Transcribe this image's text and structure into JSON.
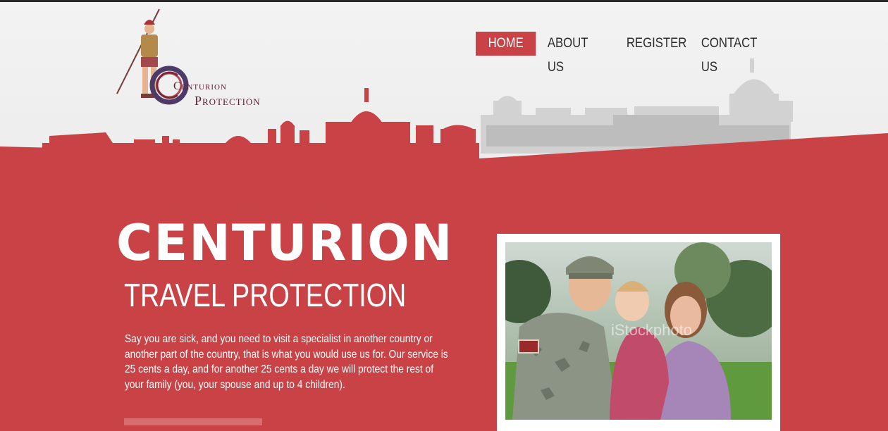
{
  "logo": {
    "word1": "Centurion",
    "word2": "Protection"
  },
  "nav": {
    "items": [
      {
        "label": "HOME",
        "active": true
      },
      {
        "label": "ABOUT US",
        "active": false
      },
      {
        "label": "REGISTER",
        "active": false
      },
      {
        "label": "CONTACT US",
        "active": false
      }
    ]
  },
  "hero": {
    "title": "CENTURION",
    "subtitle": "TRAVEL PROTECTION",
    "body": "Say you are sick, and you need to visit a specialist in another country or another part of the country, that is what you would use us for. Our service is 25 cents a day, and for another 25 cents a day we will protect the rest of your family (you, your spouse and up to 4 children)."
  },
  "photo": {
    "watermark": "iStockphoto"
  },
  "colors": {
    "brand_red": "#c94346",
    "header_bg": "#efefef",
    "nav_text": "#2b2b2b"
  }
}
